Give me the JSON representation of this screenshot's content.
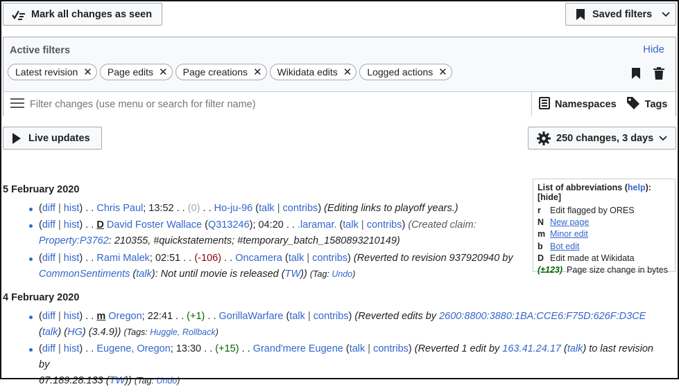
{
  "toolbar": {
    "mark_seen_label": "Mark all changes as seen",
    "saved_filters_label": "Saved filters"
  },
  "filters": {
    "title": "Active filters",
    "hide_label": "Hide",
    "chips": [
      "Latest revision",
      "Page edits",
      "Page creations",
      "Wikidata edits",
      "Logged actions"
    ],
    "search_placeholder": "Filter changes (use menu or search for filter name)",
    "namespaces_label": "Namespaces",
    "tags_label": "Tags"
  },
  "controls": {
    "live_updates_label": "Live updates",
    "changes_label": "250 changes, 3 days"
  },
  "legend": {
    "title": "List of abbreviations (",
    "help": "help",
    "close": "):[hide]",
    "rows": [
      {
        "key": "r",
        "text": "Edit flagged by ORES"
      },
      {
        "key": "N",
        "text": "New page"
      },
      {
        "key": "m",
        "text": "Minor edit"
      },
      {
        "key": "b",
        "text": "Bot edit"
      },
      {
        "key": "D",
        "text": "Edit made at Wikidata"
      },
      {
        "key": "(±123)",
        "text": "Page size change in bytes"
      }
    ]
  },
  "days": [
    {
      "date": "5 February 2020",
      "entries": [
        {
          "page": "Chris Paul",
          "time": "13:52",
          "size": "(0)",
          "user": "Ho-ju-96",
          "comment": "(Editing links to playoff years.)"
        },
        {
          "flag": "D",
          "page": "David Foster Wallace",
          "qid": "Q313246",
          "time": "04:20",
          "user": ".laramar.",
          "comment": "(Created claim:",
          "comment_link": "Property:P3762",
          "comment_rest": ": 210355, #quickstatements; #temporary_batch_1580893210149)"
        },
        {
          "page": "Rami Malek",
          "time": "02:51",
          "size": "(-106)",
          "user": "Oncamera",
          "comment": "(Reverted to revision 937920940 by",
          "comment_user": "CommonSentiments",
          "comment_talk": "talk",
          "comment_rest": "): Not until movie is released (",
          "comment_tw": "TW",
          "comment_end": "))",
          "tag_prefix": "(Tag:",
          "tag": "Undo",
          "tag_end": ")"
        }
      ]
    },
    {
      "date": "4 February 2020",
      "entries": [
        {
          "flag": "m",
          "page": "Oregon",
          "time": "22:41",
          "size": "(+1)",
          "user": "GorillaWarfare",
          "comment": "(Reverted edits by",
          "comment_ip": "2600:8800:3880:1BA:CCE6:F75D:626F:D3CE",
          "comment_talk": "talk",
          "comment_hg": "HG",
          "comment_rest": "(3.4.9))",
          "tag_prefix": "(Tags:",
          "tag": "Huggle, Rollback",
          "tag_end": ")"
        },
        {
          "page": "Eugene, Oregon",
          "time": "13:30",
          "size": "(+15)",
          "user": "Grand'mere Eugene",
          "comment": "(Reverted 1 edit by",
          "comment_ip": "163.41.24.17",
          "comment_talk": "talk",
          "comment_rest": ") to last revision by",
          "comment_ip2": "67.189.28.133",
          "comment_tw": "TW",
          "comment_end": "))",
          "tag_prefix": "(Tag:",
          "tag": "Undo",
          "tag_end": ")"
        }
      ]
    }
  ],
  "link_words": {
    "diff": "diff",
    "hist": "hist",
    "talk": "talk",
    "contribs": "contribs"
  }
}
